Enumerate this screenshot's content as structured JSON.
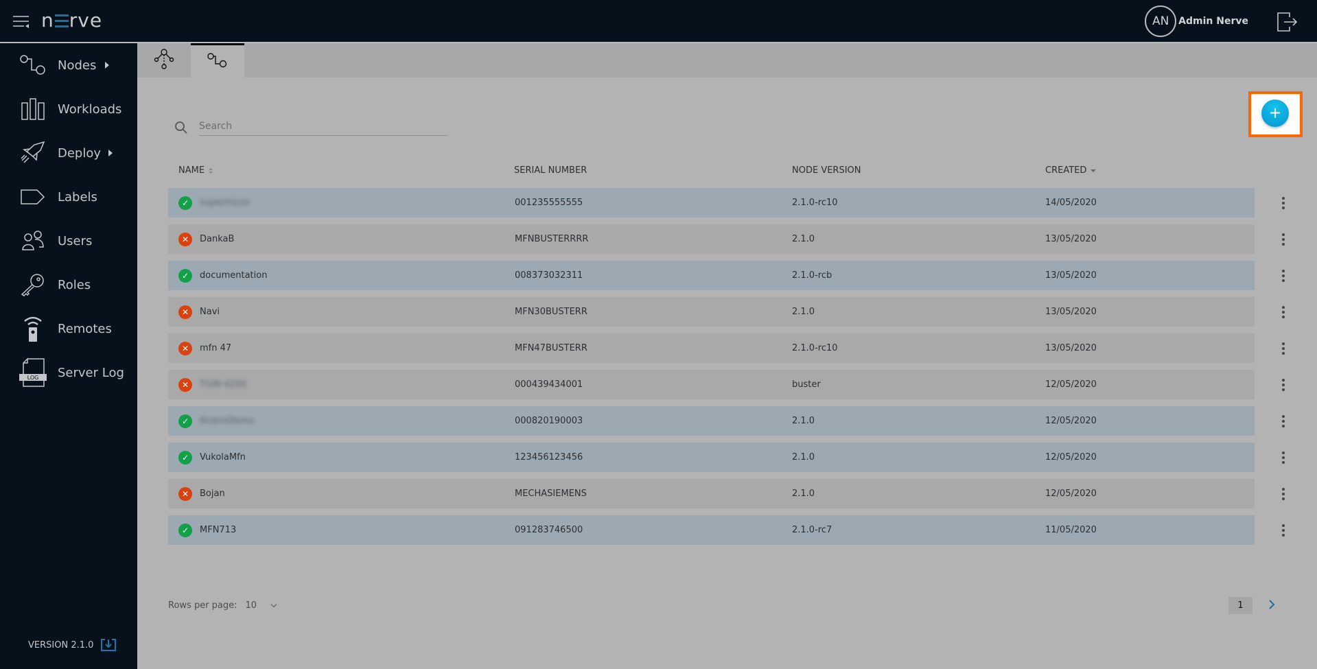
{
  "header": {
    "logo_text_left": "n",
    "logo_text_right": "rve",
    "user_initials": "AN",
    "user_name": "Admin Nerve",
    "icons": {
      "menu": "menu-collapse-icon",
      "logout": "logout-icon"
    }
  },
  "sidebar": {
    "items": [
      {
        "label": "Nodes",
        "icon": "nodes-icon",
        "has_submenu": true
      },
      {
        "label": "Workloads",
        "icon": "workloads-icon",
        "has_submenu": false
      },
      {
        "label": "Deploy",
        "icon": "rocket-icon",
        "has_submenu": true
      },
      {
        "label": "Labels",
        "icon": "label-tag-icon",
        "has_submenu": false
      },
      {
        "label": "Users",
        "icon": "users-icon",
        "has_submenu": false
      },
      {
        "label": "Roles",
        "icon": "key-icon",
        "has_submenu": false
      },
      {
        "label": "Remotes",
        "icon": "remote-icon",
        "has_submenu": false
      },
      {
        "label": "Server Log",
        "icon": "log-file-icon",
        "has_submenu": false
      }
    ],
    "log_icon_text": "LOG",
    "version": "VERSION 2.1.0"
  },
  "tabs": [
    {
      "icon": "node-tree-icon",
      "active": false
    },
    {
      "icon": "nodes-list-icon",
      "active": true
    }
  ],
  "search": {
    "placeholder": "Search",
    "value": ""
  },
  "add_button": {
    "label": "+"
  },
  "table": {
    "columns": [
      {
        "label": "NAME",
        "sort": "both"
      },
      {
        "label": "SERIAL NUMBER",
        "sort": "none"
      },
      {
        "label": "NODE VERSION",
        "sort": "none"
      },
      {
        "label": "CREATED",
        "sort": "desc"
      }
    ],
    "rows": [
      {
        "status": "online",
        "name": "supermicro",
        "name_blurred": true,
        "serial": "001235555555",
        "version": "2.1.0-rc10",
        "created": "14/05/2020"
      },
      {
        "status": "offline",
        "name": "DankaB",
        "name_blurred": false,
        "serial": "MFNBUSTERRRR",
        "version": "2.1.0",
        "created": "13/05/2020"
      },
      {
        "status": "online",
        "name": "documentation",
        "name_blurred": false,
        "serial": "008373032311",
        "version": "2.1.0-rcb",
        "created": "13/05/2020"
      },
      {
        "status": "offline",
        "name": "Navi",
        "name_blurred": false,
        "serial": "MFN30BUSTERR",
        "version": "2.1.0",
        "created": "13/05/2020"
      },
      {
        "status": "offline",
        "name": "mfn 47",
        "name_blurred": false,
        "serial": "MFN47BUSTERR",
        "version": "2.1.0-rc10",
        "created": "13/05/2020"
      },
      {
        "status": "offline",
        "name": "TGW-4200",
        "name_blurred": true,
        "serial": "000439434001",
        "version": "buster",
        "created": "12/05/2020"
      },
      {
        "status": "online",
        "name": "AndrisDemo",
        "name_blurred": true,
        "serial": "000820190003",
        "version": "2.1.0",
        "created": "12/05/2020"
      },
      {
        "status": "online",
        "name": "VukolaMfn",
        "name_blurred": false,
        "serial": "123456123456",
        "version": "2.1.0",
        "created": "12/05/2020"
      },
      {
        "status": "offline",
        "name": "Bojan",
        "name_blurred": false,
        "serial": "MECHASIEMENS",
        "version": "2.1.0",
        "created": "12/05/2020"
      },
      {
        "status": "online",
        "name": "MFN713",
        "name_blurred": false,
        "serial": "091283746500",
        "version": "2.1.0-rc7",
        "created": "11/05/2020"
      }
    ],
    "status_symbols": {
      "online": "✓",
      "offline": "✕"
    }
  },
  "pagination": {
    "rows_per_page_label": "Rows per page:",
    "rows_per_page_value": "10",
    "current_page": "1"
  },
  "colors": {
    "header_bg": "#06111b",
    "accent_blue": "#0893d0",
    "highlight_orange": "#ff6600",
    "status_online": "#14a049",
    "status_offline": "#d9420f"
  }
}
